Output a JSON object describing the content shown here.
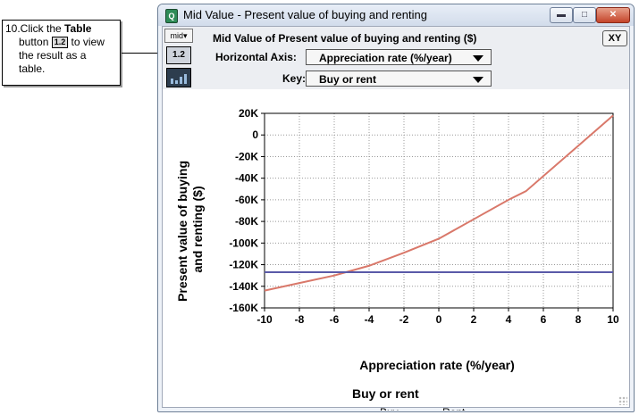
{
  "callout": {
    "line1_prefix": "10.Click the ",
    "line1_bold": "Table",
    "line2_prefix": "button ",
    "button_glyph": "1.2",
    "line2_suffix": " to view",
    "line3": "the result as a",
    "line4": "table."
  },
  "window": {
    "title": "Mid Value - Present value of buying and renting",
    "min_glyph": "▬",
    "max_glyph": "□",
    "close_glyph": "✕"
  },
  "toolbar": {
    "mid_label": "mid▾",
    "table_label": "1.2",
    "graph_icon": "graph-icon",
    "xy_label": "XY"
  },
  "header": {
    "title": "Mid Value of Present value of buying and renting ($)",
    "horizontal_axis_label": "Horizontal Axis:",
    "horizontal_axis_value": "Appreciation rate (%/year)",
    "key_label": "Key:",
    "key_value": "Buy or rent"
  },
  "colors": {
    "buy": "#d9786a",
    "rent": "#5a5aa8",
    "grid": "#999999"
  },
  "chart_data": {
    "type": "line",
    "xlabel": "Appreciation rate (%/year)",
    "ylabel": "Present value of buying and renting ($)",
    "xlim": [
      -10,
      10
    ],
    "ylim": [
      -160000,
      20000
    ],
    "x_ticks": [
      -10,
      -8,
      -6,
      -4,
      -2,
      0,
      2,
      4,
      6,
      8,
      10
    ],
    "y_ticks": [
      20000,
      0,
      -20000,
      -40000,
      -60000,
      -80000,
      -100000,
      -120000,
      -140000,
      -160000
    ],
    "y_tick_labels": [
      "20K",
      "0",
      "-20K",
      "-40K",
      "-60K",
      "-80K",
      "-100K",
      "-120K",
      "-140K",
      "-160K"
    ],
    "grid": true,
    "legend_title": "Buy or rent",
    "legend_position": "bottom",
    "series": [
      {
        "name": "Buy",
        "x": [
          -10,
          -8,
          -6,
          -4,
          -2,
          0,
          2,
          4,
          5,
          8,
          10
        ],
        "values": [
          -144000,
          -137000,
          -130000,
          -121000,
          -109000,
          -96000,
          -78000,
          -60000,
          -52000,
          -10000,
          18000
        ]
      },
      {
        "name": "Rent",
        "x": [
          -10,
          10
        ],
        "values": [
          -127000,
          -127000
        ]
      }
    ]
  }
}
